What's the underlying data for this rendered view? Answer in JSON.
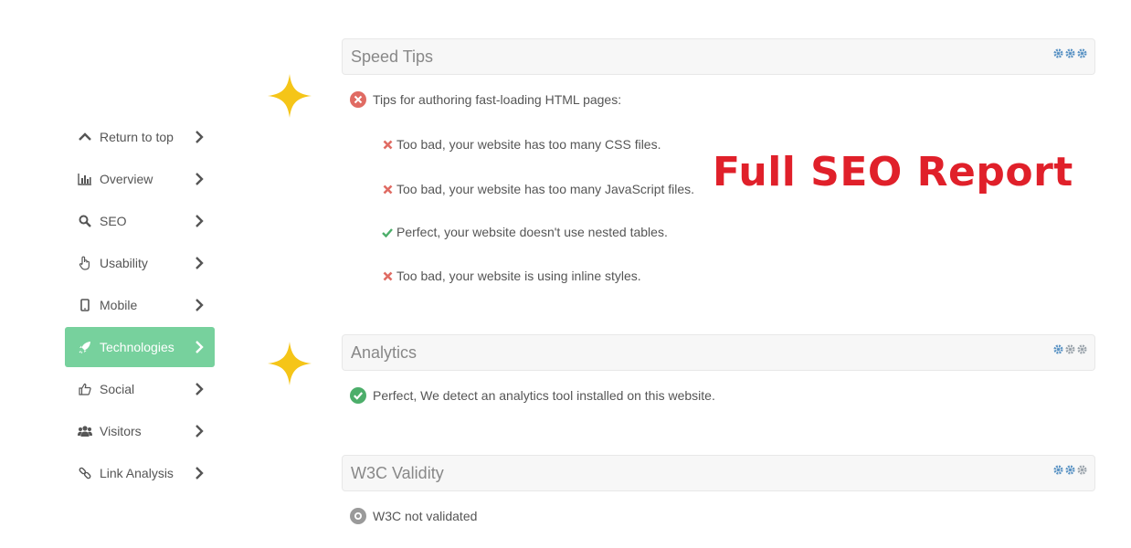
{
  "sidebar": {
    "items": [
      {
        "label": "Return to top",
        "icon": "chevron-up-icon"
      },
      {
        "label": "Overview",
        "icon": "bar-chart-icon"
      },
      {
        "label": "SEO",
        "icon": "search-icon"
      },
      {
        "label": "Usability",
        "icon": "pointer-hand-icon"
      },
      {
        "label": "Mobile",
        "icon": "mobile-icon"
      },
      {
        "label": "Technologies",
        "icon": "rocket-icon",
        "active": true
      },
      {
        "label": "Social",
        "icon": "thumbs-up-icon"
      },
      {
        "label": "Visitors",
        "icon": "users-icon"
      },
      {
        "label": "Link Analysis",
        "icon": "link-icon"
      }
    ]
  },
  "speed_tips": {
    "title": "Speed Tips",
    "summary": "Tips for authoring fast-loading HTML pages:",
    "items": [
      {
        "text": "Too bad, your website has too many CSS files.",
        "status": "fail"
      },
      {
        "text": "Too bad, your website has too many JavaScript files.",
        "status": "fail"
      },
      {
        "text": "Perfect, your website doesn't use nested tables.",
        "status": "pass"
      },
      {
        "text": "Too bad, your website is using inline styles.",
        "status": "fail"
      }
    ]
  },
  "analytics": {
    "title": "Analytics",
    "text": "Perfect, We detect an analytics tool installed on this website."
  },
  "w3c": {
    "title": "W3C Validity",
    "text": "W3C not validated"
  },
  "overlay": {
    "title": "Full SEO Report"
  },
  "colors": {
    "active_bg": "#77d19d",
    "fail": "#e06b63",
    "pass": "#4cae6a",
    "overlay_text": "#e0202a",
    "star": "#f5c518",
    "gear": "#5a93c4"
  }
}
